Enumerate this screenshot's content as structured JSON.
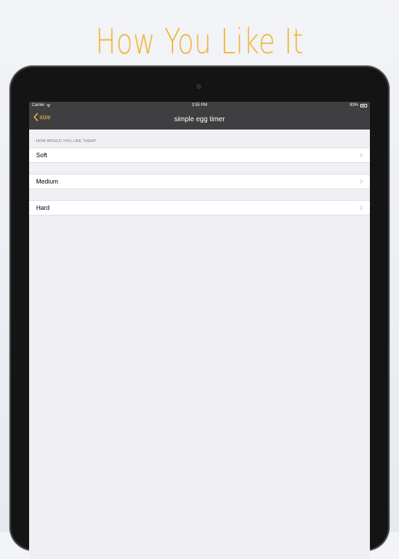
{
  "headline": "How You Like It",
  "status_bar": {
    "carrier": "Carrier",
    "time": "3:55 PM",
    "battery": "83%",
    "battery_level": 0.83
  },
  "nav_bar": {
    "back_label": "size",
    "title": "simple egg timer"
  },
  "list": {
    "section_header": "HOW WOULD YOU LIKE THEM?",
    "items": [
      {
        "label": "Soft"
      },
      {
        "label": "Medium"
      },
      {
        "label": "Hard"
      }
    ]
  },
  "colors": {
    "accent": "#f3b63a",
    "nav_background": "#3f3f41",
    "list_background": "#efeff4"
  },
  "icons": {
    "back": "chevron-left-icon",
    "disclosure": "chevron-right-icon",
    "wifi": "wifi-icon",
    "battery": "battery-icon"
  }
}
